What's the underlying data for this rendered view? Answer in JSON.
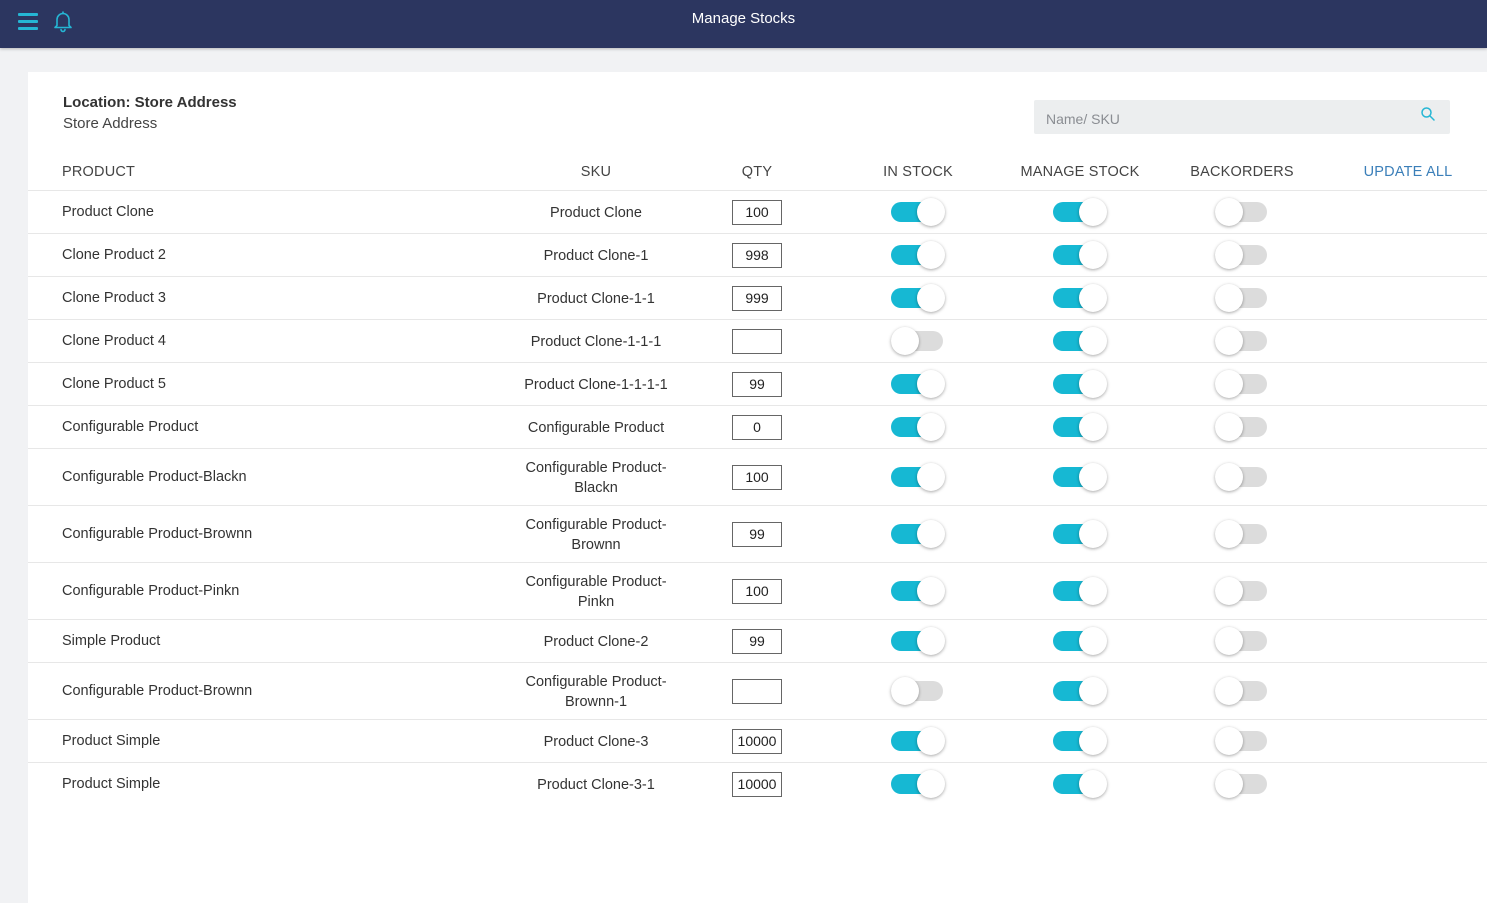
{
  "header": {
    "title": "Manage Stocks",
    "accent_color": "#25b6d4",
    "bar_color": "#2c3660"
  },
  "location": {
    "title": "Location: Store Address",
    "subtitle": "Store Address"
  },
  "search": {
    "placeholder": "Name/ SKU"
  },
  "columns": {
    "product": "PRODUCT",
    "sku": "SKU",
    "qty": "QTY",
    "in_stock": "IN STOCK",
    "manage_stock": "MANAGE STOCK",
    "backorders": "BACKORDERS",
    "update_all": "UPDATE ALL"
  },
  "rows": [
    {
      "name": "Product Clone",
      "sku": "Product Clone",
      "qty": "100",
      "in_stock": true,
      "manage_stock": true,
      "backorders": false
    },
    {
      "name": "Clone Product 2",
      "sku": "Product Clone-1",
      "qty": "998",
      "in_stock": true,
      "manage_stock": true,
      "backorders": false
    },
    {
      "name": "Clone Product 3",
      "sku": "Product Clone-1-1",
      "qty": "999",
      "in_stock": true,
      "manage_stock": true,
      "backorders": false
    },
    {
      "name": "Clone Product 4",
      "sku": "Product Clone-1-1-1",
      "qty": "",
      "in_stock": false,
      "manage_stock": true,
      "backorders": false
    },
    {
      "name": "Clone Product 5",
      "sku": "Product Clone-1-1-1-1",
      "qty": "99",
      "in_stock": true,
      "manage_stock": true,
      "backorders": false
    },
    {
      "name": "Configurable Product",
      "sku": "Configurable Product",
      "qty": "0",
      "in_stock": true,
      "manage_stock": true,
      "backorders": false
    },
    {
      "name": "Configurable Product-Blackn",
      "sku": "Configurable Product-Blackn",
      "qty": "100",
      "in_stock": true,
      "manage_stock": true,
      "backorders": false
    },
    {
      "name": "Configurable Product-Brownn",
      "sku": "Configurable Product-Brownn",
      "qty": "99",
      "in_stock": true,
      "manage_stock": true,
      "backorders": false
    },
    {
      "name": "Configurable Product-Pinkn",
      "sku": "Configurable Product-Pinkn",
      "qty": "100",
      "in_stock": true,
      "manage_stock": true,
      "backorders": false
    },
    {
      "name": "Simple Product",
      "sku": "Product Clone-2",
      "qty": "99",
      "in_stock": true,
      "manage_stock": true,
      "backorders": false
    },
    {
      "name": "Configurable Product-Brownn",
      "sku": "Configurable Product-Brownn-1",
      "qty": "",
      "in_stock": false,
      "manage_stock": true,
      "backorders": false
    },
    {
      "name": "Product Simple",
      "sku": "Product Clone-3",
      "qty": "10000",
      "in_stock": true,
      "manage_stock": true,
      "backorders": false
    },
    {
      "name": "Product Simple",
      "sku": "Product Clone-3-1",
      "qty": "10000",
      "in_stock": true,
      "manage_stock": true,
      "backorders": false
    }
  ]
}
